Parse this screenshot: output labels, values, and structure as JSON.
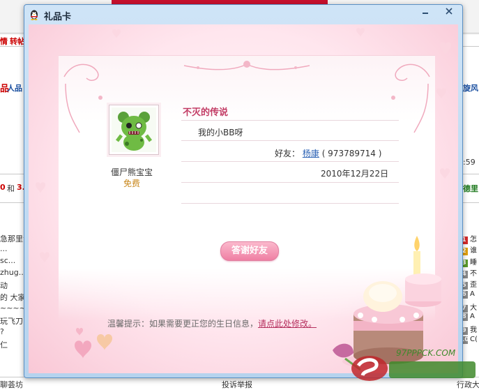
{
  "window": {
    "title": "礼品卡"
  },
  "gift": {
    "name": "僵尸熊宝宝",
    "price": "免费"
  },
  "card": {
    "title": "不灭的传说",
    "message": "我的小BB呀",
    "friend_label": "好友：",
    "friend_name": "杨康",
    "friend_qq": "( 973789714 )",
    "date": "2010年12月22日"
  },
  "buttons": {
    "thanks": "答谢好友"
  },
  "tip": {
    "text": "温馨提示：如果需要更正您的生日信息，",
    "link": "请点此处修改。"
  },
  "background_page": {
    "left_fragments": [
      "情",
      "转帖",
      "品",
      "人品",
      "0",
      "和",
      "3.",
      "急那里法",
      "...",
      "sc...",
      "zhug...",
      "动",
      "的 大家",
      "~~~~",
      "玩飞刀",
      "?",
      "仁"
    ],
    "right_fragments": [
      "旋风",
      ":59",
      "德里"
    ],
    "rank_items": [
      {
        "num": "1",
        "text": "怎",
        "color": "#d62b2b"
      },
      {
        "num": "2",
        "text": "谁",
        "color": "#e0a010"
      },
      {
        "num": "3",
        "text": "睡",
        "color": "#5a9a2a"
      },
      {
        "num": "4",
        "text": "不",
        "color": "#8a8a8a"
      },
      {
        "num": "5",
        "text": "歪",
        "color": "#8a8a8a"
      },
      {
        "num": "6",
        "text": "A",
        "color": "#8a8a8a"
      },
      {
        "num": "7",
        "text": "大",
        "color": "#8a8a8a"
      },
      {
        "num": "8",
        "text": "A",
        "color": "#8a8a8a"
      },
      {
        "num": "9",
        "text": "我",
        "color": "#8a8a8a"
      },
      {
        "num": "10",
        "text": "C(",
        "color": "#8a8a8a"
      }
    ],
    "bottom_fragments": [
      "聊荟坊",
      "投诉举报",
      "行政大"
    ]
  },
  "watermark": {
    "text": "97PPPCK.COM"
  }
}
